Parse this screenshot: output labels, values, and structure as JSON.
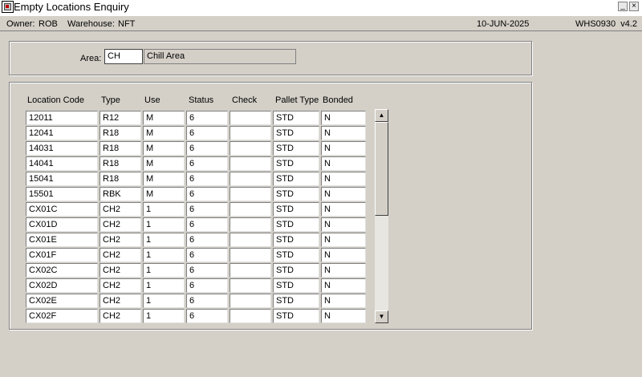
{
  "window": {
    "title": "Empty Locations Enquiry",
    "minimize_glyph": "_",
    "close_glyph": "×"
  },
  "status": {
    "owner_label": "Owner:",
    "owner_value": "ROB",
    "warehouse_label": "Warehouse:",
    "warehouse_value": "NFT",
    "date": "10-JUN-2025",
    "form_id": "WHS0930  v4.2"
  },
  "area": {
    "label": "Area:",
    "code": "CH",
    "description": "Chill Area"
  },
  "grid": {
    "headers": {
      "location_code": "Location Code",
      "type": "Type",
      "use": "Use",
      "status": "Status",
      "check": "Check",
      "pallet_type": "Pallet Type",
      "bonded": "Bonded"
    },
    "rows": [
      {
        "loc": "12011",
        "type": "R12",
        "use": "M",
        "status": "6",
        "check": "",
        "pallet": "STD",
        "bonded": "N"
      },
      {
        "loc": "12041",
        "type": "R18",
        "use": "M",
        "status": "6",
        "check": "",
        "pallet": "STD",
        "bonded": "N"
      },
      {
        "loc": "14031",
        "type": "R18",
        "use": "M",
        "status": "6",
        "check": "",
        "pallet": "STD",
        "bonded": "N"
      },
      {
        "loc": "14041",
        "type": "R18",
        "use": "M",
        "status": "6",
        "check": "",
        "pallet": "STD",
        "bonded": "N"
      },
      {
        "loc": "15041",
        "type": "R18",
        "use": "M",
        "status": "6",
        "check": "",
        "pallet": "STD",
        "bonded": "N"
      },
      {
        "loc": "15501",
        "type": "RBK",
        "use": "M",
        "status": "6",
        "check": "",
        "pallet": "STD",
        "bonded": "N"
      },
      {
        "loc": "CX01C",
        "type": "CH2",
        "use": "1",
        "status": "6",
        "check": "",
        "pallet": "STD",
        "bonded": "N"
      },
      {
        "loc": "CX01D",
        "type": "CH2",
        "use": "1",
        "status": "6",
        "check": "",
        "pallet": "STD",
        "bonded": "N"
      },
      {
        "loc": "CX01E",
        "type": "CH2",
        "use": "1",
        "status": "6",
        "check": "",
        "pallet": "STD",
        "bonded": "N"
      },
      {
        "loc": "CX01F",
        "type": "CH2",
        "use": "1",
        "status": "6",
        "check": "",
        "pallet": "STD",
        "bonded": "N"
      },
      {
        "loc": "CX02C",
        "type": "CH2",
        "use": "1",
        "status": "6",
        "check": "",
        "pallet": "STD",
        "bonded": "N"
      },
      {
        "loc": "CX02D",
        "type": "CH2",
        "use": "1",
        "status": "6",
        "check": "",
        "pallet": "STD",
        "bonded": "N"
      },
      {
        "loc": "CX02E",
        "type": "CH2",
        "use": "1",
        "status": "6",
        "check": "",
        "pallet": "STD",
        "bonded": "N"
      },
      {
        "loc": "CX02F",
        "type": "CH2",
        "use": "1",
        "status": "6",
        "check": "",
        "pallet": "STD",
        "bonded": "N"
      }
    ]
  },
  "scrollbar": {
    "up_glyph": "▲",
    "down_glyph": "▼"
  },
  "icons": {
    "app": "app-icon",
    "minimize": "minimize-icon",
    "close": "close-icon",
    "scroll_up": "scroll-up-icon",
    "scroll_down": "scroll-down-icon"
  }
}
